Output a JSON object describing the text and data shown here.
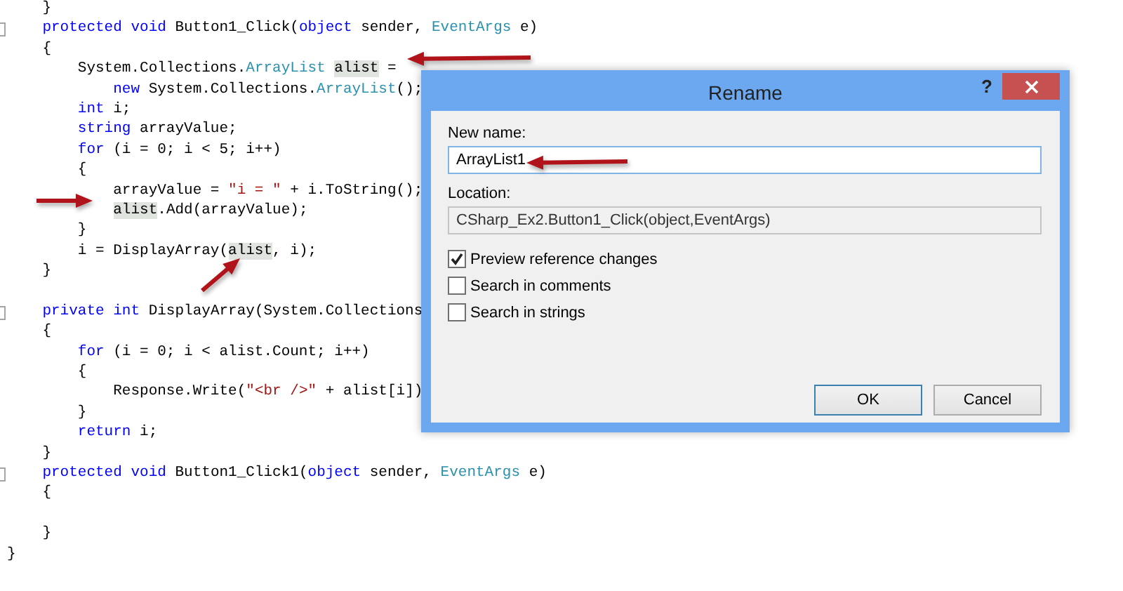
{
  "editor": {
    "lines": [
      {
        "kind": "code",
        "fold": false,
        "tokens": [
          {
            "text": "    }",
            "kind": "plain"
          }
        ]
      },
      {
        "kind": "code",
        "fold": true,
        "tokens": [
          {
            "text": "    protected",
            "kind": "keyword"
          },
          {
            "text": " void",
            "kind": "keyword"
          },
          {
            "text": " Button1_Click(",
            "kind": "plain"
          },
          {
            "text": "object",
            "kind": "keyword"
          },
          {
            "text": " sender, ",
            "kind": "plain"
          },
          {
            "text": "EventArgs",
            "kind": "type"
          },
          {
            "text": " e)",
            "kind": "plain"
          }
        ]
      },
      {
        "kind": "code",
        "fold": false,
        "tokens": [
          {
            "text": "    {",
            "kind": "plain"
          }
        ]
      },
      {
        "kind": "code",
        "fold": false,
        "tokens": [
          {
            "text": "        System.Collections.",
            "kind": "plain"
          },
          {
            "text": "ArrayList",
            "kind": "type"
          },
          {
            "text": " alist",
            "kind": "reference"
          },
          {
            "text": " =",
            "kind": "plain"
          }
        ]
      },
      {
        "kind": "code",
        "fold": false,
        "tokens": [
          {
            "text": "            new",
            "kind": "keyword"
          },
          {
            "text": " System.Collections.",
            "kind": "plain"
          },
          {
            "text": "ArrayList",
            "kind": "type"
          },
          {
            "text": "();",
            "kind": "plain"
          }
        ]
      },
      {
        "kind": "code",
        "fold": false,
        "tokens": [
          {
            "text": "        int",
            "kind": "keyword"
          },
          {
            "text": " i;",
            "kind": "plain"
          }
        ]
      },
      {
        "kind": "code",
        "fold": false,
        "tokens": [
          {
            "text": "        string",
            "kind": "keyword"
          },
          {
            "text": " arrayValue;",
            "kind": "plain"
          }
        ]
      },
      {
        "kind": "code",
        "fold": false,
        "tokens": [
          {
            "text": "        for",
            "kind": "keyword"
          },
          {
            "text": " (i = 0; i < 5; i++)",
            "kind": "plain"
          }
        ]
      },
      {
        "kind": "code",
        "fold": false,
        "tokens": [
          {
            "text": "        {",
            "kind": "plain"
          }
        ]
      },
      {
        "kind": "code",
        "fold": false,
        "tokens": [
          {
            "text": "            arrayValue = ",
            "kind": "plain"
          },
          {
            "text": "\"i = \"",
            "kind": "string"
          },
          {
            "text": " + i.ToString();",
            "kind": "plain"
          }
        ]
      },
      {
        "kind": "code",
        "fold": false,
        "tokens": [
          {
            "text": "            alist",
            "kind": "reference"
          },
          {
            "text": ".Add(arrayValue);",
            "kind": "plain"
          }
        ]
      },
      {
        "kind": "code",
        "fold": false,
        "tokens": [
          {
            "text": "        }",
            "kind": "plain"
          }
        ]
      },
      {
        "kind": "code",
        "fold": false,
        "tokens": [
          {
            "text": "        i = DisplayArray(",
            "kind": "plain"
          },
          {
            "text": "alist",
            "kind": "reference"
          },
          {
            "text": ", i);",
            "kind": "plain"
          }
        ]
      },
      {
        "kind": "code",
        "fold": false,
        "tokens": [
          {
            "text": "    }",
            "kind": "plain"
          }
        ]
      },
      {
        "kind": "blank"
      },
      {
        "kind": "code",
        "fold": true,
        "tokens": [
          {
            "text": "    private",
            "kind": "keyword"
          },
          {
            "text": " int",
            "kind": "keyword"
          },
          {
            "text": " DisplayArray(System.Collections",
            "kind": "plain"
          }
        ]
      },
      {
        "kind": "code",
        "fold": false,
        "tokens": [
          {
            "text": "    {",
            "kind": "plain"
          }
        ]
      },
      {
        "kind": "code",
        "fold": false,
        "tokens": [
          {
            "text": "        for",
            "kind": "keyword"
          },
          {
            "text": " (i = 0; i < alist.Count; i++)",
            "kind": "plain"
          }
        ]
      },
      {
        "kind": "code",
        "fold": false,
        "tokens": [
          {
            "text": "        {",
            "kind": "plain"
          }
        ]
      },
      {
        "kind": "code",
        "fold": false,
        "tokens": [
          {
            "text": "            Response.Write(",
            "kind": "plain"
          },
          {
            "text": "\"<br />\"",
            "kind": "string"
          },
          {
            "text": " + alist[i])",
            "kind": "plain"
          }
        ]
      },
      {
        "kind": "code",
        "fold": false,
        "tokens": [
          {
            "text": "        }",
            "kind": "plain"
          }
        ]
      },
      {
        "kind": "code",
        "fold": false,
        "tokens": [
          {
            "text": "        return",
            "kind": "keyword"
          },
          {
            "text": " i;",
            "kind": "plain"
          }
        ]
      },
      {
        "kind": "code",
        "fold": false,
        "tokens": [
          {
            "text": "    }",
            "kind": "plain"
          }
        ]
      },
      {
        "kind": "code",
        "fold": true,
        "tokens": [
          {
            "text": "    protected",
            "kind": "keyword"
          },
          {
            "text": " void",
            "kind": "keyword"
          },
          {
            "text": " Button1_Click1(",
            "kind": "plain"
          },
          {
            "text": "object",
            "kind": "keyword"
          },
          {
            "text": " sender, ",
            "kind": "plain"
          },
          {
            "text": "EventArgs",
            "kind": "type"
          },
          {
            "text": " e)",
            "kind": "plain"
          }
        ]
      },
      {
        "kind": "code",
        "fold": false,
        "tokens": [
          {
            "text": "    {",
            "kind": "plain"
          }
        ]
      },
      {
        "kind": "blank"
      },
      {
        "kind": "code",
        "fold": false,
        "tokens": [
          {
            "text": "    }",
            "kind": "plain"
          }
        ]
      },
      {
        "kind": "code",
        "fold": false,
        "tokens": [
          {
            "text": "}",
            "kind": "plain"
          }
        ]
      }
    ]
  },
  "dialog": {
    "title": "Rename",
    "help": "?",
    "new_name": {
      "label": "New name:",
      "value": "ArrayList1"
    },
    "location": {
      "label": "Location:",
      "value": "CSharp_Ex2.Button1_Click(object,EventArgs)"
    },
    "options": [
      {
        "label": "Preview reference changes",
        "checked": true
      },
      {
        "label": "Search in comments",
        "checked": false
      },
      {
        "label": "Search in strings",
        "checked": false
      }
    ],
    "buttons": [
      {
        "label": "OK",
        "kind": "default"
      },
      {
        "label": "Cancel",
        "kind": "normal"
      }
    ]
  }
}
